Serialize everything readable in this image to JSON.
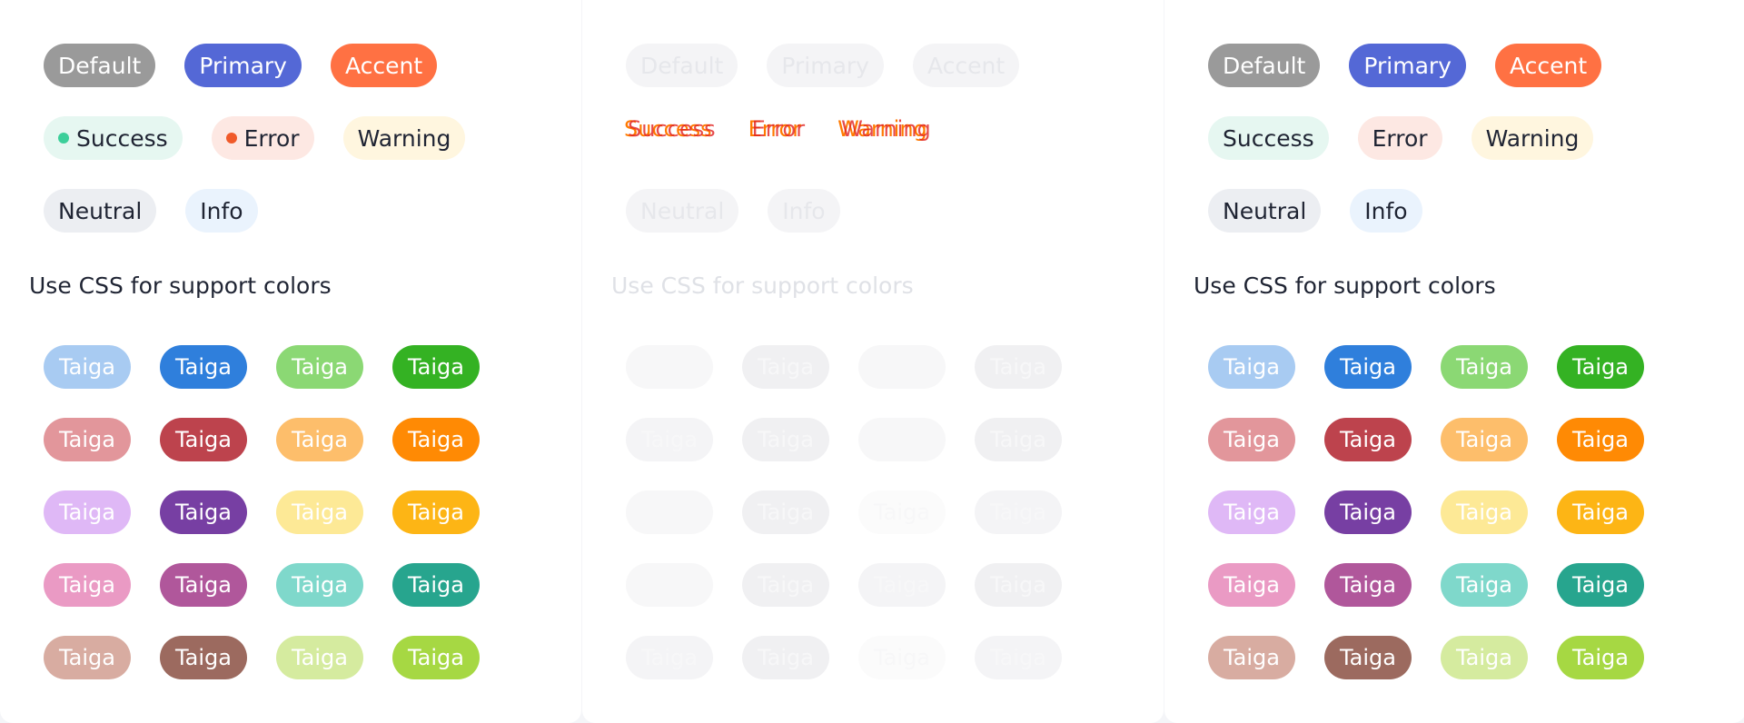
{
  "panels": [
    {
      "state": "normal",
      "row1": [
        {
          "label": "Default",
          "bg": "#9a9a9a",
          "fg": "#ffffff"
        },
        {
          "label": "Primary",
          "bg": "#5468d6",
          "fg": "#ffffff"
        },
        {
          "label": "Accent",
          "bg": "#ff7143",
          "fg": "#ffffff"
        }
      ],
      "row2": [
        {
          "label": "Success",
          "bg": "#e6f7f1",
          "dot": "#3ccf9a"
        },
        {
          "label": "Error",
          "bg": "#fde8e3",
          "dot": "#f05a2a"
        },
        {
          "label": "Warning",
          "bg": "#fff6df",
          "dot": ""
        }
      ],
      "row3": [
        {
          "label": "Neutral",
          "bg": "#eceef2"
        },
        {
          "label": "Info",
          "bg": "#eaf3fd"
        }
      ],
      "section_title": "Use CSS for support colors"
    },
    {
      "state": "disabled",
      "row1": [
        {
          "label": "Default"
        },
        {
          "label": "Primary"
        },
        {
          "label": "Accent"
        }
      ],
      "row2": [
        {
          "label": "Success"
        },
        {
          "label": "Error"
        },
        {
          "label": "Warning"
        }
      ],
      "row3": [
        {
          "label": "Neutral"
        },
        {
          "label": "Info"
        }
      ],
      "section_title": "Use CSS for support colors"
    },
    {
      "state": "normal-no-dots",
      "row1": [
        {
          "label": "Default",
          "bg": "#9a9a9a",
          "fg": "#ffffff"
        },
        {
          "label": "Primary",
          "bg": "#5468d6",
          "fg": "#ffffff"
        },
        {
          "label": "Accent",
          "bg": "#ff7143",
          "fg": "#ffffff"
        }
      ],
      "row2": [
        {
          "label": "Success",
          "bg": "#e6f7f1"
        },
        {
          "label": "Error",
          "bg": "#fde8e3"
        },
        {
          "label": "Warning",
          "bg": "#fff6df"
        }
      ],
      "row3": [
        {
          "label": "Neutral",
          "bg": "#eceef2"
        },
        {
          "label": "Info",
          "bg": "#eaf3fd"
        }
      ],
      "section_title": "Use CSS for support colors"
    }
  ],
  "taiga_label": "Taiga",
  "taiga_colors": [
    [
      "#a8cbf2",
      "#2f7fdc",
      "#8bd874",
      "#34b223"
    ],
    [
      "#e2969b",
      "#bd434d",
      "#fdbe6b",
      "#ff8a04"
    ],
    [
      "#dfb8f6",
      "#773fa3",
      "#fde996",
      "#fdb515"
    ],
    [
      "#ea9ac4",
      "#b0579b",
      "#7fd8cb",
      "#27a58e"
    ],
    [
      "#d8aca1",
      "#9c6a5f",
      "#d5eb9f",
      "#a6d843"
    ]
  ],
  "taiga_disabled_colors": [
    [
      "#f7f7f8",
      "#f0f0f2",
      "#f7f7f8",
      "#f0f0f2"
    ],
    [
      "#f4f4f6",
      "#f0f0f2",
      "#f7f7f8",
      "#f0f0f2"
    ],
    [
      "#f7f7f8",
      "#f0f0f2",
      "#fbfbfb",
      "#f4f4f6"
    ],
    [
      "#f7f7f8",
      "#f0f0f2",
      "#f4f4f6",
      "#f0f0f2"
    ],
    [
      "#f4f4f6",
      "#f0f0f2",
      "#fbfbfb",
      "#f4f4f6"
    ]
  ]
}
